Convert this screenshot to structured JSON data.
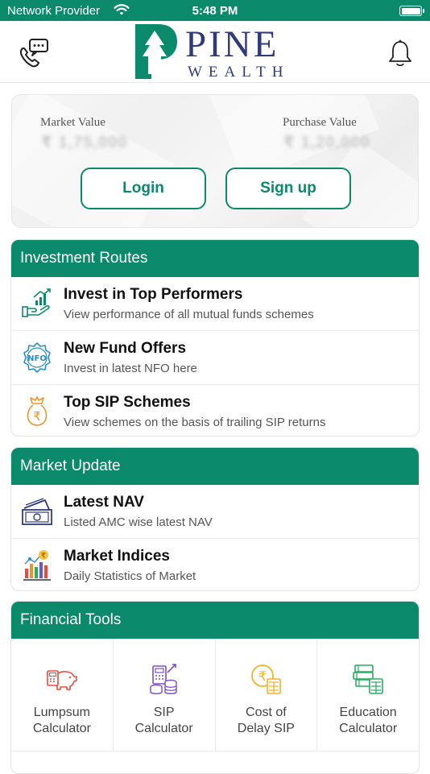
{
  "status_bar": {
    "carrier": "Network Provider",
    "time": "5:48 PM"
  },
  "header": {
    "logo_main": "PINE",
    "logo_sub": "WEALTH",
    "left_icon": "chat-phone-icon",
    "right_icon": "bell-icon"
  },
  "portfolio": {
    "market_value_label": "Market Value",
    "market_value_amount": "₹ 1,75,000",
    "purchase_value_label": "Purchase Value",
    "purchase_value_amount": "₹ 1,20,000",
    "login_label": "Login",
    "signup_label": "Sign up"
  },
  "investment_routes": {
    "title": "Investment Routes",
    "items": [
      {
        "title": "Invest in Top Performers",
        "subtitle": "View performance of all mutual funds schemes",
        "icon": "growth-hand-icon"
      },
      {
        "title": "New Fund Offers",
        "subtitle": "Invest in latest NFO here",
        "icon": "nfo-badge-icon"
      },
      {
        "title": "Top SIP Schemes",
        "subtitle": "View schemes on the basis of trailing SIP returns",
        "icon": "rupee-bag-icon"
      }
    ]
  },
  "market_update": {
    "title": "Market Update",
    "items": [
      {
        "title": "Latest NAV",
        "subtitle": "Listed AMC wise latest NAV",
        "icon": "cash-notes-icon"
      },
      {
        "title": "Market Indices",
        "subtitle": "Daily Statistics of Market",
        "icon": "bar-chart-rupee-icon"
      }
    ]
  },
  "financial_tools": {
    "title": "Financial Tools",
    "items": [
      {
        "label": "Lumpsum\nCalculator",
        "icon": "piggy-calculator-icon"
      },
      {
        "label": "SIP\nCalculator",
        "icon": "coins-calculator-icon"
      },
      {
        "label": "Cost of\nDelay SIP",
        "icon": "rupee-calculator-icon"
      },
      {
        "label": "Education\nCalculator",
        "icon": "education-calculator-icon"
      }
    ]
  },
  "colors": {
    "brand_green": "#0a8a6a",
    "brand_navy": "#2f3a7a",
    "orange": "#f0932b",
    "purple": "#7d4fc4"
  }
}
